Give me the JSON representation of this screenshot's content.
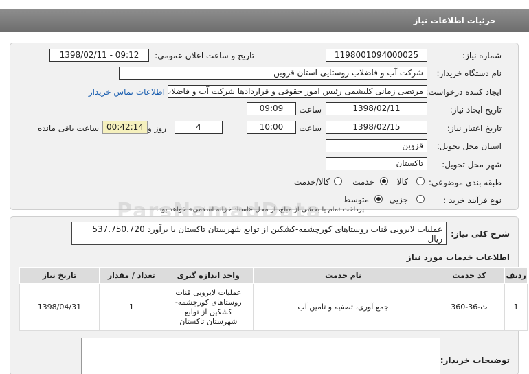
{
  "header": {
    "title": "جزئیات اطلاعات نیاز"
  },
  "form": {
    "need_number_label": "شماره نیاز:",
    "need_number": "1198001094000025",
    "announce_label": "تاریخ و ساعت اعلان عمومی:",
    "announce_value": "1398/02/11 - 09:12",
    "buyer_org_label": "نام دستگاه خریدار:",
    "buyer_org": "شرکت آب و فاضلاب روستایی استان قزوین",
    "creator_label": "ایجاد کننده درخواست:",
    "creator": "مرتضی زمانی کلیشمی رئیس امور حقوقی و قراردادها شرکت آب و فاضلاب روستایی",
    "contact_link": "اطلاعات تماس خریدار",
    "created_date_label": "تاریخ ایجاد نیاز:",
    "created_date": "1398/02/11",
    "time_label": "ساعت",
    "created_time": "09:09",
    "validity_label": "تاریخ اعتبار نیاز:",
    "validity_date": "1398/02/15",
    "validity_time": "10:00",
    "days": "4",
    "days_label": "روز و",
    "remaining": "00:42:14",
    "remaining_label": "ساعت باقی مانده",
    "province_label": "استان محل تحویل:",
    "province": "قزوین",
    "city_label": "شهر محل تحویل:",
    "city": "تاکستان",
    "category_label": "طبقه بندی موضوعی:",
    "category_options": [
      "کالا",
      "خدمت",
      "کالا/خدمت"
    ],
    "category_selected": "خدمت",
    "process_label": "نوع فرآیند خرید :",
    "process_options": [
      "جزیی",
      "متوسط"
    ],
    "process_selected": "متوسط",
    "process_note": "پرداخت تمام یا بخشی از مبلغ، از محل «اسناد خزانه اسلامی» خواهد بود."
  },
  "summary": {
    "label": "شرح کلی نیاز:",
    "text": "عملیات لایروبی قنات روستاهای کورچشمه-کشکین از توابع شهرستان تاکستان با برآورد 537.750.720 ریال"
  },
  "services": {
    "title": "اطلاعات خدمات مورد نیاز",
    "columns": [
      "ردیف",
      "کد خدمت",
      "نام خدمت",
      "واحد اندازه گیری",
      "تعداد / مقدار",
      "تاریخ نیاز"
    ],
    "rows": [
      [
        "1",
        "ث-36-360",
        "جمع آوری، تصفیه و تامین آب",
        "عملیات لایروبی قنات روستاهای کورچشمه-کشکین از توابع شهرستان تاکستان",
        "1",
        "1398/04/31"
      ]
    ]
  },
  "buyer_notes": {
    "label": "توضیحات خریدار:",
    "text": ""
  },
  "watermark": "ParsNamadData"
}
